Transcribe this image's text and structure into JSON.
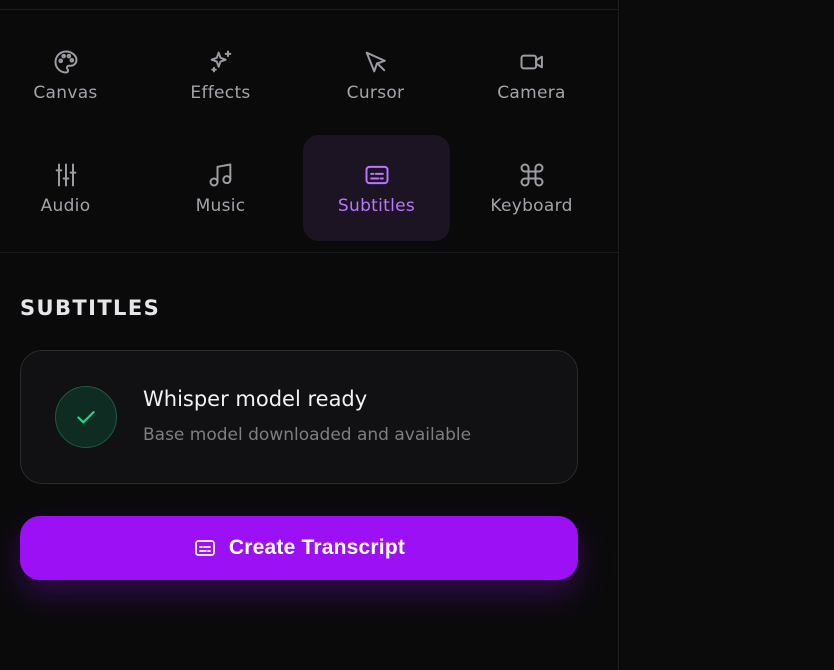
{
  "tabs": [
    {
      "label": "Canvas",
      "icon": "palette-icon"
    },
    {
      "label": "Effects",
      "icon": "sparkles-icon"
    },
    {
      "label": "Cursor",
      "icon": "cursor-icon"
    },
    {
      "label": "Camera",
      "icon": "camera-icon"
    },
    {
      "label": "Audio",
      "icon": "sliders-icon"
    },
    {
      "label": "Music",
      "icon": "music-icon"
    },
    {
      "label": "Subtitles",
      "icon": "subtitles-icon",
      "active": true
    },
    {
      "label": "Keyboard",
      "icon": "command-icon"
    }
  ],
  "section": {
    "title": "SUBTITLES"
  },
  "status": {
    "title": "Whisper model ready",
    "subtitle": "Base model downloaded and available",
    "icon": "check-icon",
    "color": "#2fd08a"
  },
  "create_button": {
    "label": "Create Transcript",
    "icon": "subtitles-icon"
  },
  "colors": {
    "accent": "#9b10f5",
    "active_tab_text": "#b877ff",
    "background": "#0a0a0b"
  }
}
